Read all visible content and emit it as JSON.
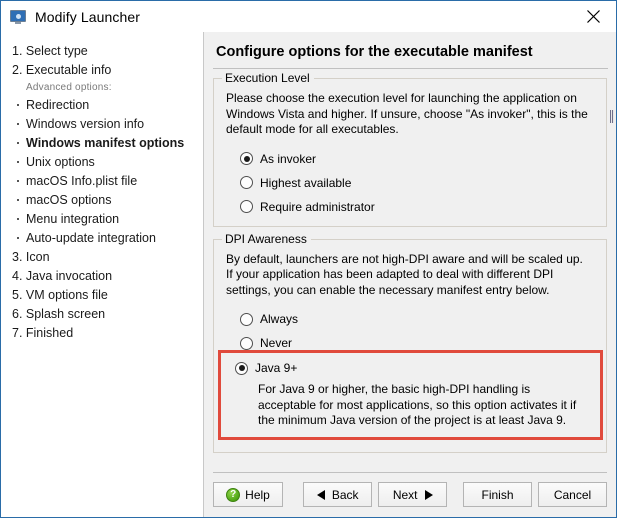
{
  "window": {
    "title": "Modify Launcher",
    "icon": "monitor-icon",
    "close_label": "×",
    "accent_border": "#2a6ca8"
  },
  "sidebar": {
    "steps": [
      {
        "label": "1. Select type",
        "type": "step"
      },
      {
        "label": "2. Executable info",
        "type": "step"
      },
      {
        "label": "Advanced options:",
        "type": "advanced-header"
      },
      {
        "label": "Redirection",
        "type": "sub"
      },
      {
        "label": "Windows version info",
        "type": "sub"
      },
      {
        "label": "Windows manifest options",
        "type": "sub",
        "selected": true
      },
      {
        "label": "Unix options",
        "type": "sub"
      },
      {
        "label": "macOS Info.plist file",
        "type": "sub"
      },
      {
        "label": "macOS options",
        "type": "sub"
      },
      {
        "label": "Menu integration",
        "type": "sub"
      },
      {
        "label": "Auto-update integration",
        "type": "sub"
      },
      {
        "label": "3. Icon",
        "type": "step"
      },
      {
        "label": "4. Java invocation",
        "type": "step"
      },
      {
        "label": "5. VM options file",
        "type": "step"
      },
      {
        "label": "6. Splash screen",
        "type": "step"
      },
      {
        "label": "7. Finished",
        "type": "step"
      }
    ]
  },
  "panel": {
    "header": "Configure options for the executable manifest",
    "execution_level": {
      "legend": "Execution Level",
      "description": "Please choose the execution level for launching the application on Windows Vista and higher. If unsure, choose \"As invoker\", this is the default mode for all executables.",
      "options": [
        {
          "label": "As invoker",
          "selected": true
        },
        {
          "label": "Highest available",
          "selected": false
        },
        {
          "label": "Require administrator",
          "selected": false
        }
      ]
    },
    "dpi_awareness": {
      "legend": "DPI Awareness",
      "description": "By default, launchers are not high-DPI aware and will be scaled up. If your application has been adapted to deal with different DPI settings, you can enable the necessary manifest entry below.",
      "options": [
        {
          "label": "Always",
          "selected": false
        },
        {
          "label": "Never",
          "selected": false
        }
      ],
      "highlighted_option": {
        "label": "Java 9+",
        "selected": true,
        "description": "For Java 9 or higher, the basic high-DPI handling is acceptable for most applications, so this option activates it if the minimum Java version of the project is at least Java 9.",
        "highlight_color": "#e04a3c"
      }
    }
  },
  "footer": {
    "help": {
      "label": "Help",
      "icon": "help-question-icon",
      "icon_glyph": "?",
      "icon_color": "#4ca313"
    },
    "back": {
      "label": "Back",
      "icon": "triangle-left-icon"
    },
    "next": {
      "label": "Next",
      "icon": "triangle-right-icon"
    },
    "finish": {
      "label": "Finish"
    },
    "cancel": {
      "label": "Cancel"
    }
  }
}
